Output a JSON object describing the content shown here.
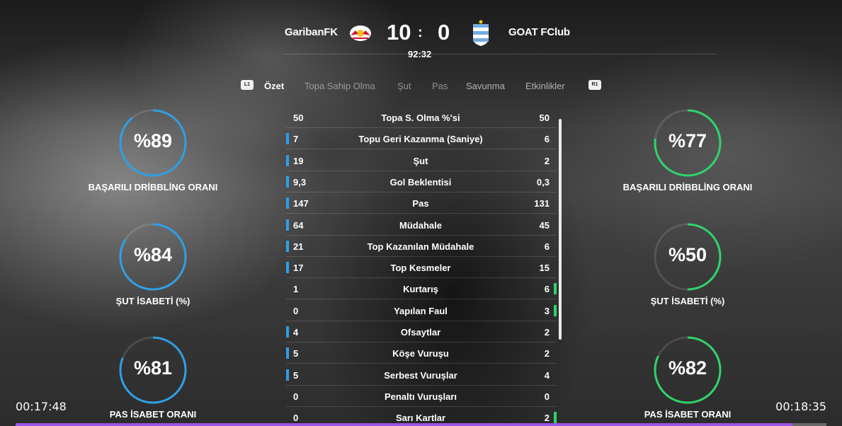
{
  "header": {
    "home_team": "GaribanFK",
    "away_team": "GOAT FClub",
    "home_score": "10",
    "away_score": "0",
    "separator": ":",
    "match_time": "92:32",
    "home_crest_icon": "rb-bull-crest-icon",
    "away_crest_icon": "argentina-crest-icon"
  },
  "tabs": {
    "left_button": "L1",
    "right_button": "R1",
    "items": [
      {
        "label": "Özet",
        "active": true
      },
      {
        "label": "Topa Sahip Olma",
        "active": false
      },
      {
        "label": "Şut",
        "active": false
      },
      {
        "label": "Pas",
        "active": false
      },
      {
        "label": "Savunma",
        "active": false
      },
      {
        "label": "Etkinlikler",
        "active": false
      }
    ]
  },
  "left_donuts": [
    {
      "value": "%89",
      "percent": 89,
      "label": "BAŞARILI DRİBBLİNG ORANI"
    },
    {
      "value": "%84",
      "percent": 84,
      "label": "ŞUT İSABETİ (%)"
    },
    {
      "value": "%81",
      "percent": 81,
      "label": "PAS İSABET ORANI"
    }
  ],
  "right_donuts": [
    {
      "value": "%77",
      "percent": 77,
      "label": "BAŞARILI DRİBBLİNG ORANI"
    },
    {
      "value": "%50",
      "percent": 50,
      "label": "ŞUT İSABETİ (%)"
    },
    {
      "value": "%82",
      "percent": 82,
      "label": "PAS İSABET ORANI"
    }
  ],
  "stats": [
    {
      "left": "50",
      "label": "Topa S. Olma %'si",
      "right": "50",
      "lead": "none"
    },
    {
      "left": "7",
      "label": "Topu Geri Kazanma (Saniye)",
      "right": "6",
      "lead": "left"
    },
    {
      "left": "19",
      "label": "Şut",
      "right": "2",
      "lead": "left"
    },
    {
      "left": "9,3",
      "label": "Gol Beklentisi",
      "right": "0,3",
      "lead": "left"
    },
    {
      "left": "147",
      "label": "Pas",
      "right": "131",
      "lead": "left"
    },
    {
      "left": "64",
      "label": "Müdahale",
      "right": "45",
      "lead": "left"
    },
    {
      "left": "21",
      "label": "Top Kazanılan Müdahale",
      "right": "6",
      "lead": "left"
    },
    {
      "left": "17",
      "label": "Top Kesmeler",
      "right": "15",
      "lead": "left"
    },
    {
      "left": "1",
      "label": "Kurtarış",
      "right": "6",
      "lead": "right"
    },
    {
      "left": "0",
      "label": "Yapılan Faul",
      "right": "3",
      "lead": "right"
    },
    {
      "left": "4",
      "label": "Ofsaytlar",
      "right": "2",
      "lead": "left"
    },
    {
      "left": "5",
      "label": "Köşe Vuruşu",
      "right": "2",
      "lead": "left"
    },
    {
      "left": "5",
      "label": "Serbest Vuruşlar",
      "right": "4",
      "lead": "left"
    },
    {
      "left": "0",
      "label": "Penaltı Vuruşları",
      "right": "0",
      "lead": "none"
    },
    {
      "left": "0",
      "label": "Sarı Kartlar",
      "right": "2",
      "lead": "right"
    }
  ],
  "colors": {
    "home_accent": "#2f9fe6",
    "away_accent": "#2fd46b",
    "progress_fill": "#9b55e8"
  },
  "video": {
    "elapsed": "00:17:48",
    "duration": "00:18:35",
    "progress": 0.958
  }
}
